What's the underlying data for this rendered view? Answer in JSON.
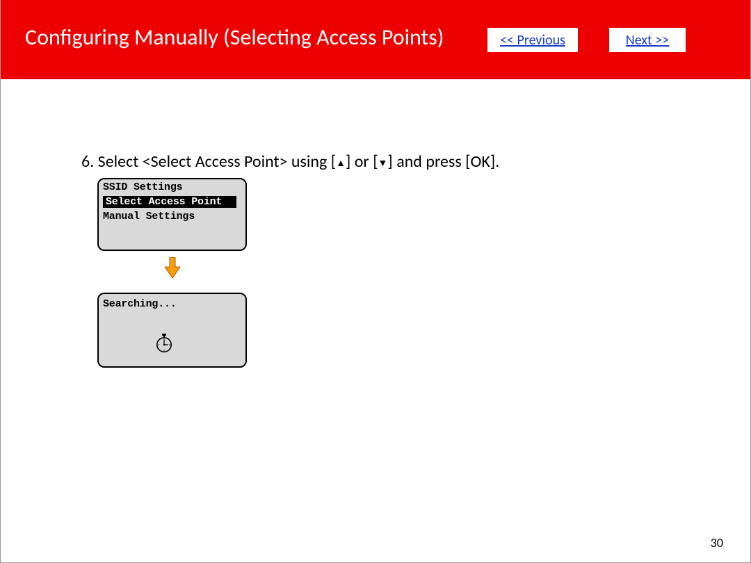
{
  "header": {
    "title": "Configuring Manually (Selecting Access Points)",
    "prev_label": "<< Previous",
    "next_label": "Next >>"
  },
  "instruction": {
    "number": "6.",
    "prefix": "Select <Select Access Point> using [",
    "mid": "] or [",
    "suffix": "] and press [OK]."
  },
  "lcd1": {
    "title": "SSID Settings",
    "selected": "Select Access Point",
    "line2": "Manual Settings"
  },
  "lcd2": {
    "status": "Searching..."
  },
  "page_number": "30"
}
